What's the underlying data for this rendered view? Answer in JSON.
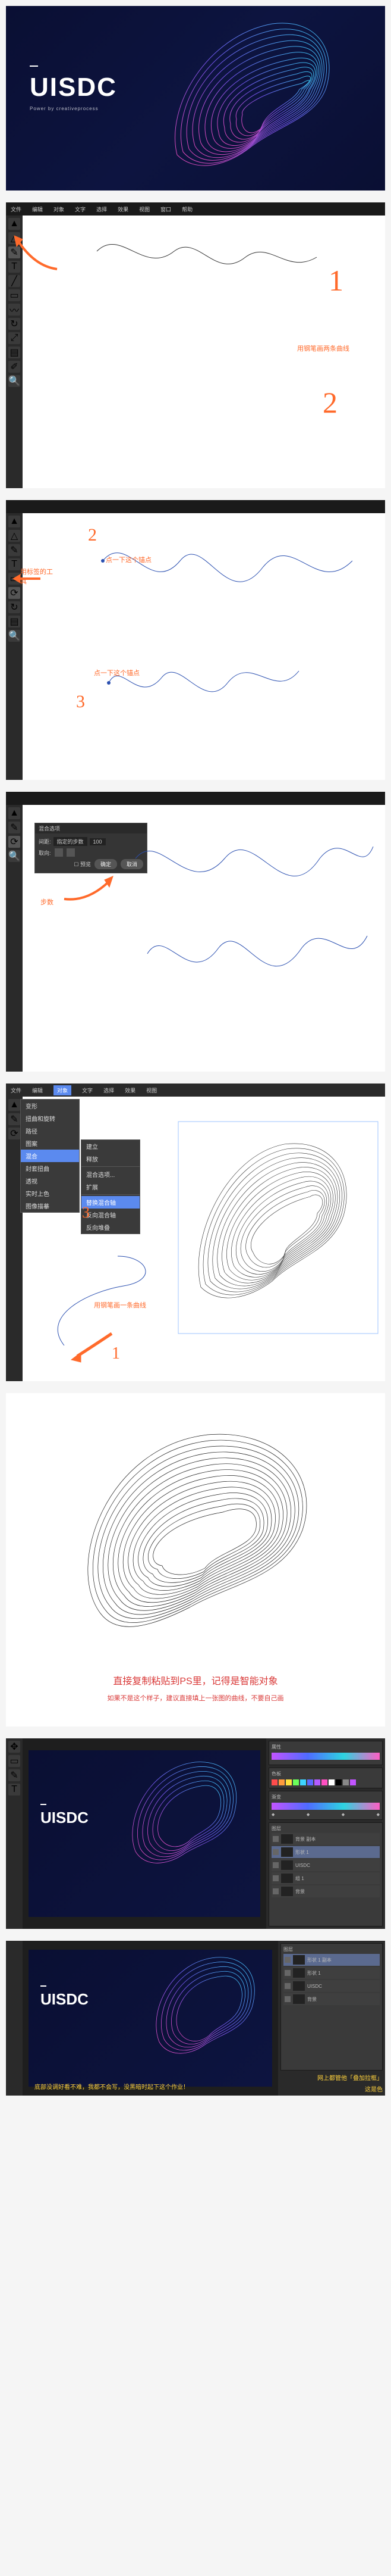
{
  "hero": {
    "brand": "UISDC",
    "subtitle": "Power by creativeprocess"
  },
  "app": {
    "menubar": [
      "文件",
      "编辑",
      "对象",
      "文字",
      "选择",
      "效果",
      "视图",
      "窗口",
      "帮助"
    ]
  },
  "step2": {
    "num1": "1",
    "num2": "2",
    "label": "用钢笔画两条曲线"
  },
  "step3": {
    "num2": "2",
    "num3": "3",
    "left_label": "用标签的工具",
    "anchor_label_top": "点一下这个锚点",
    "anchor_label_bottom": "点一下这个锚点"
  },
  "step4": {
    "panel_title": "混合选项",
    "spacing_label": "间距:",
    "spacing_value": "指定的步数",
    "spacing_num": "100",
    "orientation_label": "取向:",
    "preview": "预览",
    "ok": "确定",
    "cancel": "取消",
    "arrow_label": "步数"
  },
  "step5": {
    "num1": "1",
    "num3": "3",
    "ctx_items_top": [
      "对象(O)"
    ],
    "ctx_items": [
      "变形",
      "扭曲和旋转",
      "路径",
      "图案",
      "混合",
      "封套扭曲",
      "透视",
      "实时上色",
      "图像描摹"
    ],
    "ctx_sub": [
      "建立",
      "释放",
      "混合选项...",
      "扩展",
      "替换混合轴",
      "反向混合轴",
      "反向堆叠"
    ],
    "label": "用钢笔画一条曲线"
  },
  "step6": {
    "title": "直接复制粘贴到PS里，记得是智能对象",
    "sub": "如果不是这个样子，建议直接填上一张图的曲线，不要自己画"
  },
  "step7": {
    "panels": {
      "properties": "属性",
      "gradient": "渐变",
      "swatches": "色板",
      "layers": "图层"
    },
    "layers": [
      "背景 副本",
      "形状 1",
      "UISDC",
      "组 1",
      "背景"
    ]
  },
  "step8": {
    "note_left": "底部没调好看不难，我都不会写，没黑暗时起下这个作业！",
    "note_right_1": "网上都管他「叠加拉框」",
    "note_right_2": "这是色",
    "layers_title": "图层",
    "layers": [
      "形状 1 副本",
      "形状 1",
      "UISDC",
      "背景"
    ]
  }
}
